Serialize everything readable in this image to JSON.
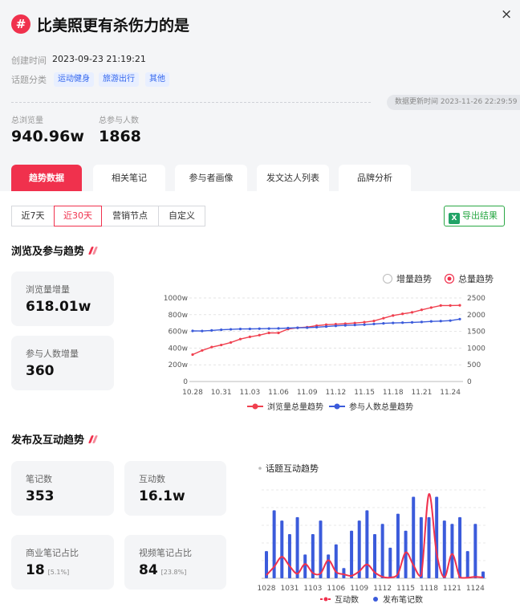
{
  "header": {
    "title": "比美照更有杀伤力的是",
    "created_label": "创建时间",
    "created_value": "2023-09-23 21:19:21",
    "category_label": "话题分类",
    "tags": [
      "运动健身",
      "旅游出行",
      "其他"
    ],
    "update_text": "数据更新时间 2023-11-26 22:29:59",
    "close_icon": "×",
    "hash_icon": "#"
  },
  "stats": {
    "views_label": "总浏览量",
    "views_value": "940.96w",
    "participants_label": "总参与人数",
    "participants_value": "1868"
  },
  "tabs": [
    {
      "label": "趋势数据",
      "active": true
    },
    {
      "label": "相关笔记",
      "active": false
    },
    {
      "label": "参与者画像",
      "active": false
    },
    {
      "label": "发文达人列表",
      "active": false
    },
    {
      "label": "品牌分析",
      "active": false
    }
  ],
  "range_buttons": [
    {
      "label": "近7天",
      "active": false
    },
    {
      "label": "近30天",
      "active": true
    },
    {
      "label": "营销节点",
      "active": false
    },
    {
      "label": "自定义",
      "active": false
    }
  ],
  "export_label": "导出结果",
  "export_icon": "X",
  "section1": {
    "title": "浏览及参与趋势",
    "cards": [
      {
        "label": "浏览量增量",
        "value": "618.01w"
      },
      {
        "label": "参与人数增量",
        "value": "360"
      }
    ],
    "toggle": [
      {
        "label": "增量趋势",
        "selected": false
      },
      {
        "label": "总量趋势",
        "selected": true
      }
    ]
  },
  "section2": {
    "title": "发布及互动趋势",
    "cards": [
      {
        "label": "笔记数",
        "value": "353",
        "sub": ""
      },
      {
        "label": "互动数",
        "value": "16.1w",
        "sub": ""
      },
      {
        "label": "商业笔记占比",
        "value": "18",
        "sub": "[5.1%]"
      },
      {
        "label": "视频笔记占比",
        "value": "84",
        "sub": "[23.8%]"
      }
    ],
    "chart_title": "话题互动趋势"
  },
  "colors": {
    "accent": "#f0314d",
    "blue": "#3b5bdb",
    "red": "#f0404f",
    "green": "#2aa845"
  },
  "chart_data": [
    {
      "type": "line",
      "x": [
        "10.28",
        "10.29",
        "10.30",
        "10.31",
        "11.01",
        "11.02",
        "11.03",
        "11.04",
        "11.05",
        "11.06",
        "11.07",
        "11.08",
        "11.09",
        "11.10",
        "11.11",
        "11.12",
        "11.13",
        "11.14",
        "11.15",
        "11.16",
        "11.17",
        "11.18",
        "11.19",
        "11.20",
        "11.21",
        "11.22",
        "11.23",
        "11.24",
        "11.25"
      ],
      "x_tick_labels": [
        "10.28",
        "10.31",
        "11.03",
        "11.06",
        "11.09",
        "11.12",
        "11.15",
        "11.18",
        "11.21",
        "11.24"
      ],
      "y_left_ticks": [
        "0",
        "200w",
        "400w",
        "600w",
        "800w",
        "1000w"
      ],
      "y_right_ticks": [
        "0",
        "500",
        "1000",
        "1500",
        "2000",
        "2500"
      ],
      "ylim_left": [
        0,
        1000
      ],
      "ylim_right": [
        0,
        2500
      ],
      "legend_position": "bottom",
      "grid": true,
      "series": [
        {
          "name": "浏览量总量趋势",
          "axis": "left",
          "color": "#f0404f",
          "values": [
            322,
            372,
            412,
            437,
            467,
            508,
            535,
            555,
            582,
            582,
            628,
            643,
            651,
            668,
            680,
            686,
            692,
            700,
            710,
            725,
            758,
            790,
            810,
            828,
            858,
            885,
            910,
            910,
            912
          ]
        },
        {
          "name": "参与人数总量趋势",
          "axis": "right",
          "color": "#3b5bdb",
          "values": [
            1515,
            1512,
            1530,
            1548,
            1561,
            1571,
            1575,
            1580,
            1584,
            1590,
            1598,
            1608,
            1612,
            1625,
            1645,
            1665,
            1680,
            1691,
            1701,
            1722,
            1740,
            1752,
            1760,
            1770,
            1781,
            1799,
            1808,
            1823,
            1868
          ]
        }
      ]
    },
    {
      "type": "bar",
      "title": "话题互动趋势",
      "x": [
        "1028",
        "1029",
        "1030",
        "1031",
        "1101",
        "1102",
        "1103",
        "1104",
        "1105",
        "1106",
        "1107",
        "1108",
        "1109",
        "1110",
        "1111",
        "1112",
        "1113",
        "1114",
        "1115",
        "1116",
        "1117",
        "1118",
        "1119",
        "1120",
        "1121",
        "1122",
        "1123",
        "1124",
        "1125"
      ],
      "x_tick_labels": [
        "1028",
        "1031",
        "1103",
        "1106",
        "1109",
        "1112",
        "1115",
        "1118",
        "1121",
        "1124"
      ],
      "legend_position": "bottom",
      "grid": true,
      "series": [
        {
          "name": "发布笔记数",
          "kind": "bar",
          "color": "#3b5bdb",
          "values": [
            8,
            20,
            17,
            13,
            18,
            7,
            13,
            17,
            7,
            10,
            3,
            14,
            17,
            20,
            13,
            16,
            9,
            19,
            14,
            24,
            18,
            18,
            24,
            17,
            16,
            18,
            8,
            16,
            2
          ]
        },
        {
          "name": "互动数",
          "kind": "line",
          "color": "#f0314d",
          "values": [
            1500,
            5500,
            10200,
            5800,
            2200,
            6800,
            2500,
            2300,
            8600,
            3000,
            1900,
            1200,
            3300,
            6600,
            2800,
            700,
            400,
            2100,
            12300,
            6200,
            1300,
            40000,
            11900,
            500,
            11600,
            400,
            300,
            700,
            350
          ]
        }
      ]
    }
  ]
}
